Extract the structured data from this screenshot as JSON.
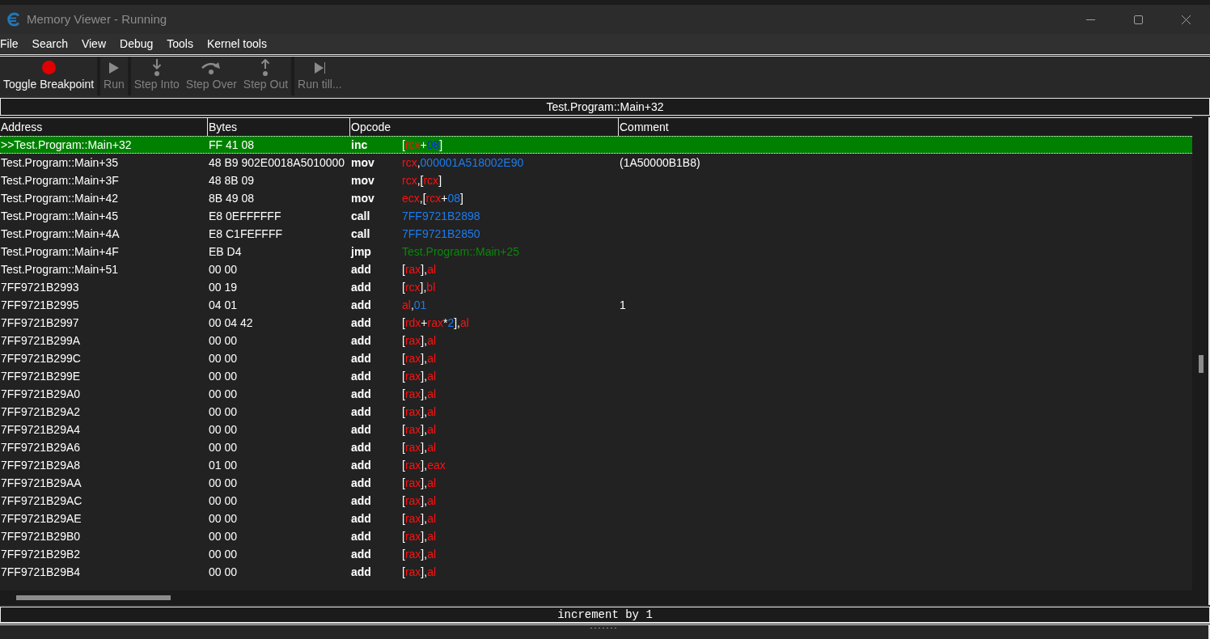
{
  "window": {
    "title": "Memory Viewer - Running"
  },
  "menu": [
    "File",
    "Search",
    "View",
    "Debug",
    "Tools",
    "Kernel tools"
  ],
  "toolbar": [
    {
      "buttons": [
        {
          "kind": "breakpoint",
          "label": "Toggle Breakpoint",
          "disabled": false
        }
      ]
    },
    {
      "buttons": [
        {
          "kind": "run",
          "label": "Run",
          "disabled": true
        }
      ]
    },
    {
      "buttons": [
        {
          "kind": "step_into",
          "label": "Step Into",
          "disabled": true
        },
        {
          "kind": "step_over",
          "label": "Step Over",
          "disabled": true
        },
        {
          "kind": "step_out",
          "label": "Step Out",
          "disabled": true
        }
      ]
    },
    {
      "buttons": [
        {
          "kind": "run_till",
          "label": "Run till...",
          "disabled": true
        }
      ]
    }
  ],
  "address_bar": {
    "value": "Test.Program::Main+32"
  },
  "disassembly": {
    "columns": [
      "Address",
      "Bytes",
      "Opcode",
      "Comment"
    ],
    "rows": [
      {
        "address": ">>Test.Program::Main+32",
        "bytes": "FF 41 08",
        "mnemonic": "inc",
        "operand": [
          {
            "text": "[",
            "kind": "plain"
          },
          {
            "text": "rcx",
            "kind": "register"
          },
          {
            "text": "+",
            "kind": "plain"
          },
          {
            "text": "08",
            "kind": "number"
          },
          {
            "text": "]",
            "kind": "plain"
          }
        ],
        "selected": true
      },
      {
        "address": "Test.Program::Main+35",
        "bytes": "48 B9 902E0018A5010000",
        "mnemonic": "mov",
        "operand": [
          {
            "text": "rcx",
            "kind": "register"
          },
          {
            "text": ",",
            "kind": "plain"
          },
          {
            "text": "000001A518002E90",
            "kind": "number"
          }
        ],
        "comment": "(1A50000B1B8)",
        "selected": false
      },
      {
        "address": "Test.Program::Main+3F",
        "bytes": "48 8B 09",
        "mnemonic": "mov",
        "operand": [
          {
            "text": "rcx",
            "kind": "register"
          },
          {
            "text": ",[",
            "kind": "plain"
          },
          {
            "text": "rcx",
            "kind": "register"
          },
          {
            "text": "]",
            "kind": "plain"
          }
        ],
        "selected": false
      },
      {
        "address": "Test.Program::Main+42",
        "bytes": "8B 49 08",
        "mnemonic": "mov",
        "operand": [
          {
            "text": "ecx",
            "kind": "register"
          },
          {
            "text": ",[",
            "kind": "plain"
          },
          {
            "text": "rcx",
            "kind": "register"
          },
          {
            "text": "+",
            "kind": "plain"
          },
          {
            "text": "08",
            "kind": "number"
          },
          {
            "text": "]",
            "kind": "plain"
          }
        ],
        "selected": false
      },
      {
        "address": "Test.Program::Main+45",
        "bytes": "E8 0EFFFFFF",
        "mnemonic": "call",
        "operand": [
          {
            "text": "7FF9721B2898",
            "kind": "number"
          }
        ],
        "selected": false
      },
      {
        "address": "Test.Program::Main+4A",
        "bytes": "E8 C1FEFFFF",
        "mnemonic": "call",
        "operand": [
          {
            "text": "7FF9721B2850",
            "kind": "number"
          }
        ],
        "selected": false
      },
      {
        "address": "Test.Program::Main+4F",
        "bytes": "EB D4",
        "mnemonic": "jmp",
        "operand": [
          {
            "text": "Test.Program::Main+25",
            "kind": "symbol"
          }
        ],
        "selected": false
      },
      {
        "address": "Test.Program::Main+51",
        "bytes": "00 00",
        "mnemonic": "add",
        "operand": [
          {
            "text": "[",
            "kind": "plain"
          },
          {
            "text": "rax",
            "kind": "register"
          },
          {
            "text": "],",
            "kind": "plain"
          },
          {
            "text": "al",
            "kind": "register"
          }
        ],
        "selected": false
      },
      {
        "address": "7FF9721B2993",
        "bytes": "00 19",
        "mnemonic": "add",
        "operand": [
          {
            "text": "[",
            "kind": "plain"
          },
          {
            "text": "rcx",
            "kind": "register"
          },
          {
            "text": "],",
            "kind": "plain"
          },
          {
            "text": "bl",
            "kind": "register"
          }
        ],
        "selected": false
      },
      {
        "address": "7FF9721B2995",
        "bytes": "04 01",
        "mnemonic": "add",
        "operand": [
          {
            "text": "al",
            "kind": "register"
          },
          {
            "text": ",",
            "kind": "plain"
          },
          {
            "text": "01",
            "kind": "number"
          }
        ],
        "comment": "1",
        "selected": false
      },
      {
        "address": "7FF9721B2997",
        "bytes": "00 04 42",
        "mnemonic": "add",
        "operand": [
          {
            "text": "[",
            "kind": "plain"
          },
          {
            "text": "rdx",
            "kind": "register"
          },
          {
            "text": "+",
            "kind": "plain"
          },
          {
            "text": "rax",
            "kind": "register"
          },
          {
            "text": "*",
            "kind": "plain"
          },
          {
            "text": "2",
            "kind": "number"
          },
          {
            "text": "],",
            "kind": "plain"
          },
          {
            "text": "al",
            "kind": "register"
          }
        ],
        "selected": false
      },
      {
        "address": "7FF9721B299A",
        "bytes": "00 00",
        "mnemonic": "add",
        "operand": [
          {
            "text": "[",
            "kind": "plain"
          },
          {
            "text": "rax",
            "kind": "register"
          },
          {
            "text": "],",
            "kind": "plain"
          },
          {
            "text": "al",
            "kind": "register"
          }
        ],
        "selected": false
      },
      {
        "address": "7FF9721B299C",
        "bytes": "00 00",
        "mnemonic": "add",
        "operand": [
          {
            "text": "[",
            "kind": "plain"
          },
          {
            "text": "rax",
            "kind": "register"
          },
          {
            "text": "],",
            "kind": "plain"
          },
          {
            "text": "al",
            "kind": "register"
          }
        ],
        "selected": false
      },
      {
        "address": "7FF9721B299E",
        "bytes": "00 00",
        "mnemonic": "add",
        "operand": [
          {
            "text": "[",
            "kind": "plain"
          },
          {
            "text": "rax",
            "kind": "register"
          },
          {
            "text": "],",
            "kind": "plain"
          },
          {
            "text": "al",
            "kind": "register"
          }
        ],
        "selected": false
      },
      {
        "address": "7FF9721B29A0",
        "bytes": "00 00",
        "mnemonic": "add",
        "operand": [
          {
            "text": "[",
            "kind": "plain"
          },
          {
            "text": "rax",
            "kind": "register"
          },
          {
            "text": "],",
            "kind": "plain"
          },
          {
            "text": "al",
            "kind": "register"
          }
        ],
        "selected": false
      },
      {
        "address": "7FF9721B29A2",
        "bytes": "00 00",
        "mnemonic": "add",
        "operand": [
          {
            "text": "[",
            "kind": "plain"
          },
          {
            "text": "rax",
            "kind": "register"
          },
          {
            "text": "],",
            "kind": "plain"
          },
          {
            "text": "al",
            "kind": "register"
          }
        ],
        "selected": false
      },
      {
        "address": "7FF9721B29A4",
        "bytes": "00 00",
        "mnemonic": "add",
        "operand": [
          {
            "text": "[",
            "kind": "plain"
          },
          {
            "text": "rax",
            "kind": "register"
          },
          {
            "text": "],",
            "kind": "plain"
          },
          {
            "text": "al",
            "kind": "register"
          }
        ],
        "selected": false
      },
      {
        "address": "7FF9721B29A6",
        "bytes": "00 00",
        "mnemonic": "add",
        "operand": [
          {
            "text": "[",
            "kind": "plain"
          },
          {
            "text": "rax",
            "kind": "register"
          },
          {
            "text": "],",
            "kind": "plain"
          },
          {
            "text": "al",
            "kind": "register"
          }
        ],
        "selected": false
      },
      {
        "address": "7FF9721B29A8",
        "bytes": "01 00",
        "mnemonic": "add",
        "operand": [
          {
            "text": "[",
            "kind": "plain"
          },
          {
            "text": "rax",
            "kind": "register"
          },
          {
            "text": "],",
            "kind": "plain"
          },
          {
            "text": "eax",
            "kind": "register"
          }
        ],
        "selected": false
      },
      {
        "address": "7FF9721B29AA",
        "bytes": "00 00",
        "mnemonic": "add",
        "operand": [
          {
            "text": "[",
            "kind": "plain"
          },
          {
            "text": "rax",
            "kind": "register"
          },
          {
            "text": "],",
            "kind": "plain"
          },
          {
            "text": "al",
            "kind": "register"
          }
        ],
        "selected": false
      },
      {
        "address": "7FF9721B29AC",
        "bytes": "00 00",
        "mnemonic": "add",
        "operand": [
          {
            "text": "[",
            "kind": "plain"
          },
          {
            "text": "rax",
            "kind": "register"
          },
          {
            "text": "],",
            "kind": "plain"
          },
          {
            "text": "al",
            "kind": "register"
          }
        ],
        "selected": false
      },
      {
        "address": "7FF9721B29AE",
        "bytes": "00 00",
        "mnemonic": "add",
        "operand": [
          {
            "text": "[",
            "kind": "plain"
          },
          {
            "text": "rax",
            "kind": "register"
          },
          {
            "text": "],",
            "kind": "plain"
          },
          {
            "text": "al",
            "kind": "register"
          }
        ],
        "selected": false
      },
      {
        "address": "7FF9721B29B0",
        "bytes": "00 00",
        "mnemonic": "add",
        "operand": [
          {
            "text": "[",
            "kind": "plain"
          },
          {
            "text": "rax",
            "kind": "register"
          },
          {
            "text": "],",
            "kind": "plain"
          },
          {
            "text": "al",
            "kind": "register"
          }
        ],
        "selected": false
      },
      {
        "address": "7FF9721B29B2",
        "bytes": "00 00",
        "mnemonic": "add",
        "operand": [
          {
            "text": "[",
            "kind": "plain"
          },
          {
            "text": "rax",
            "kind": "register"
          },
          {
            "text": "],",
            "kind": "plain"
          },
          {
            "text": "al",
            "kind": "register"
          }
        ],
        "selected": false
      },
      {
        "address": "7FF9721B29B4",
        "bytes": "00 00",
        "mnemonic": "add",
        "operand": [
          {
            "text": "[",
            "kind": "plain"
          },
          {
            "text": "rax",
            "kind": "register"
          },
          {
            "text": "],",
            "kind": "plain"
          },
          {
            "text": "al",
            "kind": "register"
          }
        ],
        "selected": false
      }
    ]
  },
  "status": {
    "text": "increment by 1"
  }
}
